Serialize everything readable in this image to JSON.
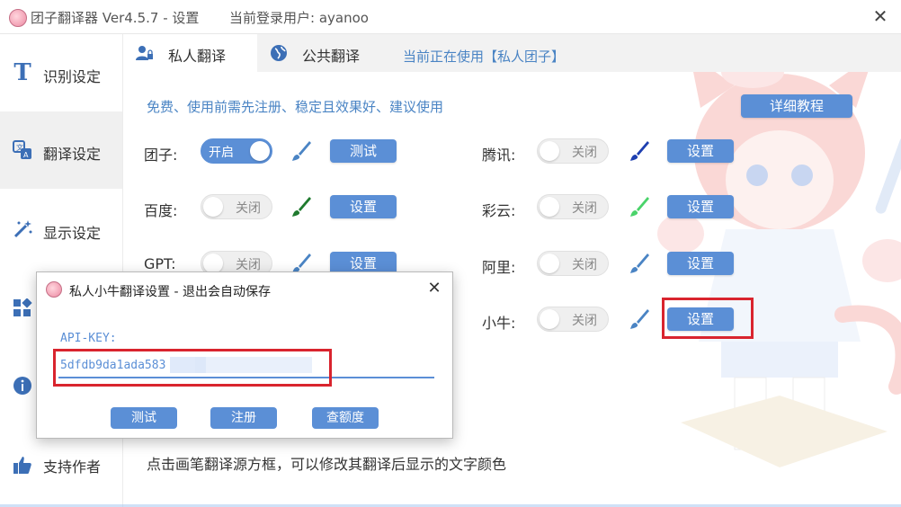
{
  "window": {
    "title": "团子翻译器 Ver4.5.7 - 设置",
    "user_info": "当前登录用户: ayanoo",
    "close_label": "✕"
  },
  "sidebar": {
    "items": [
      {
        "label": "识别设定",
        "icon": "letter-t-icon",
        "active": false
      },
      {
        "label": "翻译设定",
        "icon": "translate-icon",
        "active": true
      },
      {
        "label": "显示设定",
        "icon": "magic-wand-icon",
        "active": false
      },
      {
        "label": "",
        "icon": "grid-icon",
        "active": false
      },
      {
        "label": "",
        "icon": "info-icon",
        "active": false
      },
      {
        "label": "支持作者",
        "icon": "thumbs-up-icon",
        "active": false
      }
    ]
  },
  "tabs": [
    {
      "label": "私人翻译",
      "icon": "user-lock-icon",
      "active": true
    },
    {
      "label": "公共翻译",
      "icon": "globe-icon",
      "active": false
    }
  ],
  "current_use": "当前正在使用【私人团子】",
  "tip": "免费、使用前需先注册、稳定且效果好、建议使用",
  "tutorial_button": "详细教程",
  "services_left": [
    {
      "name": "团子:",
      "toggle": "开启",
      "on": true,
      "brush_color": "#4a84c4",
      "button": "测试"
    },
    {
      "name": "百度:",
      "toggle": "关闭",
      "on": false,
      "brush_color": "#1f7a2e",
      "button": "设置"
    },
    {
      "name": "GPT:",
      "toggle": "关闭",
      "on": false,
      "brush_color": "#4a84c4",
      "button": "设置"
    }
  ],
  "services_right": [
    {
      "name": "腾讯:",
      "toggle": "关闭",
      "on": false,
      "brush_color": "#1e3fb0",
      "button": "设置"
    },
    {
      "name": "彩云:",
      "toggle": "关闭",
      "on": false,
      "brush_color": "#4ad36a",
      "button": "设置"
    },
    {
      "name": "阿里:",
      "toggle": "关闭",
      "on": false,
      "brush_color": "#4a84c4",
      "button": "设置"
    },
    {
      "name": "小牛:",
      "toggle": "关闭",
      "on": false,
      "brush_color": "#4a84c4",
      "button": "设置"
    }
  ],
  "bottom_text": "点击画笔翻译源方框，可以修改其翻译后显示的文字颜色",
  "dialog": {
    "title": "私人小牛翻译设置 - 退出会自动保存",
    "close_label": "✕",
    "apikey_label": "API-KEY:",
    "apikey_value": "5dfdb9da1ada583",
    "buttons": [
      "测试",
      "注册",
      "查额度"
    ]
  },
  "colors": {
    "accent": "#5b8fd6",
    "text_blue": "#4a84c4",
    "highlight_red": "#d9242e"
  }
}
